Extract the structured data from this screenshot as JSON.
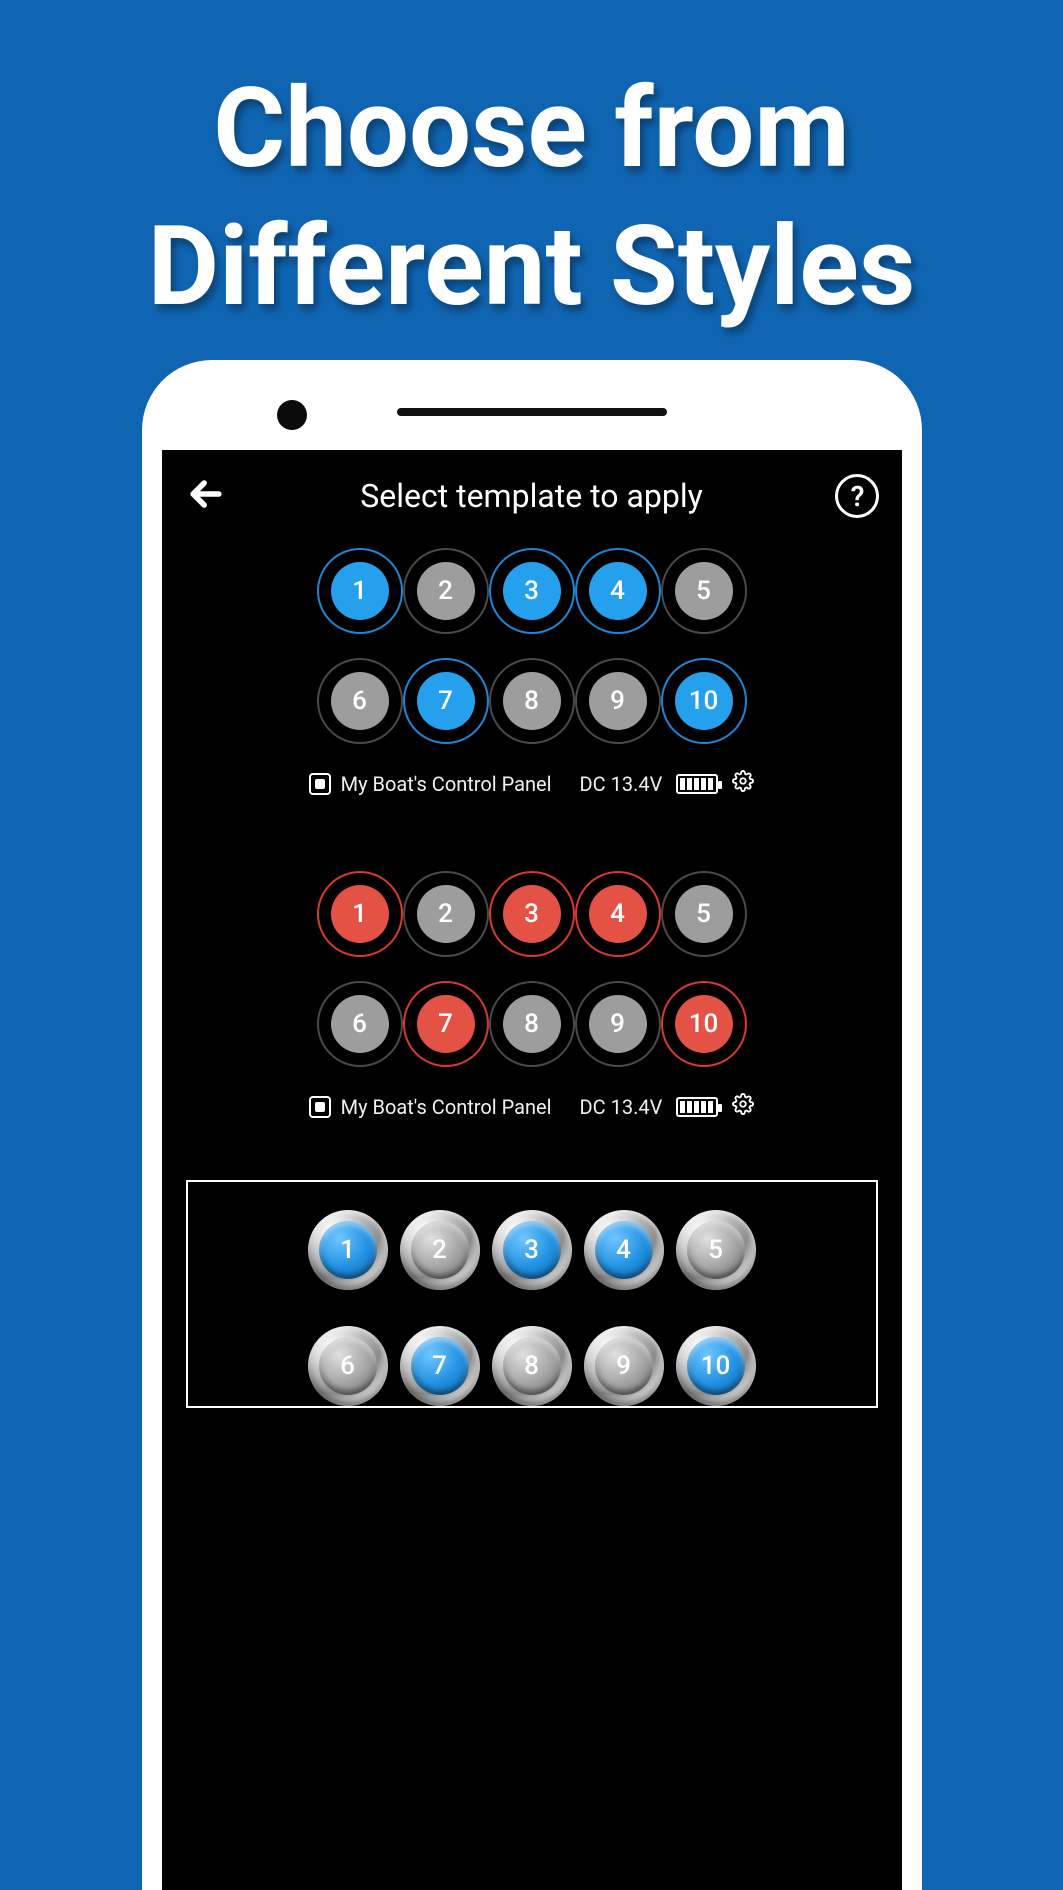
{
  "promo": {
    "heading": "Choose from Different Styles"
  },
  "screen": {
    "title": "Select template to apply"
  },
  "templates": [
    {
      "style": "flat-blue",
      "buttons": [
        {
          "label": "1",
          "on": true
        },
        {
          "label": "2",
          "on": false
        },
        {
          "label": "3",
          "on": true
        },
        {
          "label": "4",
          "on": true
        },
        {
          "label": "5",
          "on": false
        },
        {
          "label": "6",
          "on": false
        },
        {
          "label": "7",
          "on": true
        },
        {
          "label": "8",
          "on": false
        },
        {
          "label": "9",
          "on": false
        },
        {
          "label": "10",
          "on": true
        }
      ],
      "panel_label": "My Boat's Control Panel",
      "voltage": "DC 13.4V"
    },
    {
      "style": "flat-red",
      "buttons": [
        {
          "label": "1",
          "on": true
        },
        {
          "label": "2",
          "on": false
        },
        {
          "label": "3",
          "on": true
        },
        {
          "label": "4",
          "on": true
        },
        {
          "label": "5",
          "on": false
        },
        {
          "label": "6",
          "on": false
        },
        {
          "label": "7",
          "on": true
        },
        {
          "label": "8",
          "on": false
        },
        {
          "label": "9",
          "on": false
        },
        {
          "label": "10",
          "on": true
        }
      ],
      "panel_label": "My Boat's Control Panel",
      "voltage": "DC 13.4V"
    },
    {
      "style": "metal",
      "buttons": [
        {
          "label": "1",
          "on": true
        },
        {
          "label": "2",
          "on": false
        },
        {
          "label": "3",
          "on": true
        },
        {
          "label": "4",
          "on": true
        },
        {
          "label": "5",
          "on": false
        },
        {
          "label": "6",
          "on": false
        },
        {
          "label": "7",
          "on": true
        },
        {
          "label": "8",
          "on": false
        },
        {
          "label": "9",
          "on": false
        },
        {
          "label": "10",
          "on": true
        }
      ]
    }
  ]
}
